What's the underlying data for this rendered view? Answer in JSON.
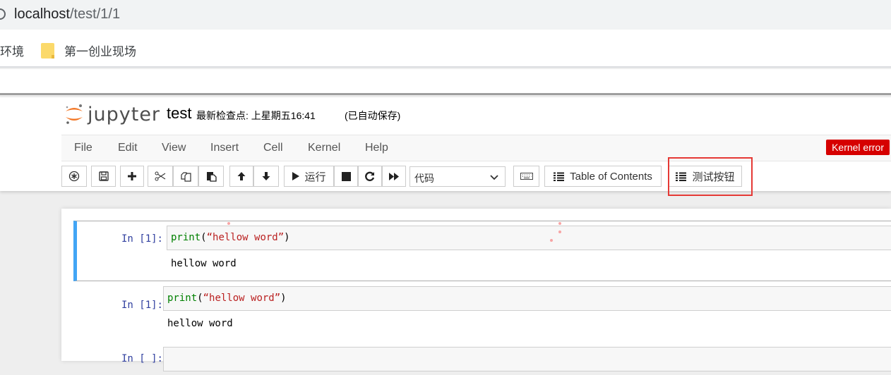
{
  "browser": {
    "url_host": "localhost",
    "url_path": "/test/1/1",
    "bookmarks": [
      {
        "label": "环境",
        "icon": "none"
      },
      {
        "label": "第一创业现场",
        "icon": "folder-icon"
      }
    ]
  },
  "header": {
    "logo_text": "jupyter",
    "notebook_title": "test",
    "checkpoint": "最新检查点: 上星期五16:41",
    "autosave": "(已自动保存)"
  },
  "menu": {
    "items": [
      "File",
      "Edit",
      "View",
      "Insert",
      "Cell",
      "Kernel",
      "Help"
    ],
    "kernel_status": "Kernel error",
    "kernel_status_color": "#d60000"
  },
  "toolbar": {
    "run_label": "运行",
    "cell_type": "代码",
    "toc_label": "Table of Contents",
    "test_button_label": "测试按钮",
    "highlight_color": "#e53935"
  },
  "cells": [
    {
      "prompt": "In  [1]:",
      "code_fn": "print",
      "code_open": "(",
      "code_str": "“hellow word”",
      "code_close": ")",
      "output": "hellow word",
      "selected": true
    },
    {
      "prompt": "In  [1]:",
      "code_fn": "print",
      "code_open": "(",
      "code_str": "“hellow word”",
      "code_close": ")",
      "output": "hellow word",
      "selected": false
    },
    {
      "prompt": "In  [ ]:",
      "code_fn": "",
      "code_open": "",
      "code_str": "",
      "code_close": "",
      "output": "",
      "selected": false
    }
  ],
  "colors": {
    "selected_cell_bar": "#42a5f5",
    "prompt": "#303f9f",
    "keyword": "#008000",
    "string": "#ba2121"
  }
}
